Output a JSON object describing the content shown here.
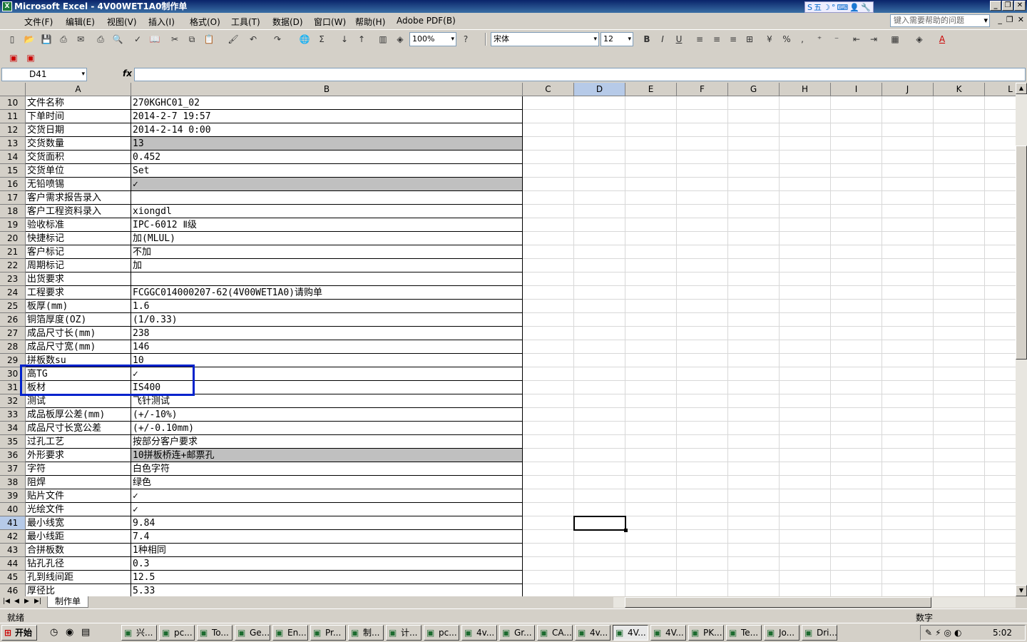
{
  "window": {
    "title": "Microsoft Excel - 4V00WET1A0制作单",
    "minimize": "_",
    "restore": "❐",
    "close": "✕"
  },
  "ime": {
    "items": [
      "S",
      "五",
      "☽",
      "°",
      "⌨",
      "👤",
      "🔧"
    ]
  },
  "menu": {
    "items": [
      "文件(F)",
      "编辑(E)",
      "视图(V)",
      "插入(I)",
      "格式(O)",
      "工具(T)",
      "数据(D)",
      "窗口(W)",
      "帮助(H)",
      "Adobe PDF(B)"
    ],
    "help_placeholder": "键入需要帮助的问题"
  },
  "toolbar": {
    "zoom": "100%",
    "font": "宋体",
    "size": "12",
    "bold": "B",
    "italic": "I",
    "underline": "U",
    "percent": "%",
    "comma": ","
  },
  "formula": {
    "name_box": "D41",
    "fx": "fx",
    "content": ""
  },
  "columns": [
    {
      "label": "A"
    },
    {
      "label": "B"
    },
    {
      "label": "C"
    },
    {
      "label": "D"
    },
    {
      "label": "E"
    },
    {
      "label": "F"
    },
    {
      "label": "G"
    },
    {
      "label": "H"
    },
    {
      "label": "I"
    },
    {
      "label": "J"
    },
    {
      "label": "K"
    },
    {
      "label": "L"
    }
  ],
  "rows": [
    {
      "n": "10",
      "a": "文件名称",
      "b": "270KGHC01_02",
      "shade": false
    },
    {
      "n": "11",
      "a": "下单时间",
      "b": "2014-2-7 19:57",
      "shade": false
    },
    {
      "n": "12",
      "a": "交货日期",
      "b": "2014-2-14 0:00",
      "shade": false
    },
    {
      "n": "13",
      "a": "交货数量",
      "b": "13",
      "shade": true
    },
    {
      "n": "14",
      "a": "交货面积",
      "b": "0.452",
      "shade": false
    },
    {
      "n": "15",
      "a": "交货单位",
      "b": "Set",
      "shade": false
    },
    {
      "n": "16",
      "a": "无铅喷锡",
      "b": "✓",
      "shade": true
    },
    {
      "n": "17",
      "a": "客户需求报告录入",
      "b": "",
      "shade": false
    },
    {
      "n": "18",
      "a": "客户工程资料录入",
      "b": "xiongdl",
      "shade": false
    },
    {
      "n": "19",
      "a": "验收标准",
      "b": "IPC-6012 Ⅱ级",
      "shade": false
    },
    {
      "n": "20",
      "a": "快捷标记",
      "b": "加(MLUL)",
      "shade": false
    },
    {
      "n": "21",
      "a": "客户标记",
      "b": "不加",
      "shade": false
    },
    {
      "n": "22",
      "a": "周期标记",
      "b": "加",
      "shade": false
    },
    {
      "n": "23",
      "a": "出货要求",
      "b": "",
      "shade": false
    },
    {
      "n": "24",
      "a": "工程要求",
      "b": "FCGGC014000207-62(4V00WET1A0)请购单",
      "shade": false
    },
    {
      "n": "25",
      "a": "板厚(mm)",
      "b": "1.6",
      "shade": false
    },
    {
      "n": "26",
      "a": "铜箔厚度(OZ)",
      "b": "(1/0.33)",
      "shade": false
    },
    {
      "n": "27",
      "a": "成品尺寸长(mm)",
      "b": "238",
      "shade": false
    },
    {
      "n": "28",
      "a": "成品尺寸宽(mm)",
      "b": "146",
      "shade": false
    },
    {
      "n": "29",
      "a": "拼板数su",
      "b": "10",
      "shade": false
    },
    {
      "n": "30",
      "a": "高TG",
      "b": "✓",
      "shade": false
    },
    {
      "n": "31",
      "a": "板材",
      "b": "IS400",
      "shade": false
    },
    {
      "n": "32",
      "a": "测试",
      "b": "飞针测试",
      "shade": false
    },
    {
      "n": "33",
      "a": "成品板厚公差(mm)",
      "b": "(+/-10%)",
      "shade": false
    },
    {
      "n": "34",
      "a": "成品尺寸长宽公差",
      "b": "(+/-0.10mm)",
      "shade": false
    },
    {
      "n": "35",
      "a": "过孔工艺",
      "b": "按部分客户要求",
      "shade": false
    },
    {
      "n": "36",
      "a": "外形要求",
      "b": "10拼板桥连+邮票孔",
      "shade": true
    },
    {
      "n": "37",
      "a": "字符",
      "b": "白色字符",
      "shade": false
    },
    {
      "n": "38",
      "a": "阻焊",
      "b": "绿色",
      "shade": false
    },
    {
      "n": "39",
      "a": "贴片文件",
      "b": "✓",
      "shade": false
    },
    {
      "n": "40",
      "a": "光绘文件",
      "b": "✓",
      "shade": false
    },
    {
      "n": "41",
      "a": "最小线宽",
      "b": "9.84",
      "shade": false
    },
    {
      "n": "42",
      "a": "最小线距",
      "b": "7.4",
      "shade": false
    },
    {
      "n": "43",
      "a": "合拼板数",
      "b": "1种相同",
      "shade": false
    },
    {
      "n": "44",
      "a": "钻孔孔径",
      "b": "0.3",
      "shade": false
    },
    {
      "n": "45",
      "a": "孔到线间距",
      "b": "12.5",
      "shade": false
    },
    {
      "n": "46",
      "a": "厚径比",
      "b": "5.33",
      "shade": false
    }
  ],
  "sheet": {
    "tab": "制作单"
  },
  "status": {
    "left": "就绪",
    "right": "数字"
  },
  "taskbar": {
    "start": "开始",
    "tasks": [
      "兴...",
      "pc...",
      "To...",
      "Ge...",
      "En...",
      "Pr...",
      "制...",
      "计...",
      "pc...",
      "4v...",
      "Gr...",
      "CA...",
      "4v...",
      "4V...",
      "4V...",
      "PK...",
      "Te...",
      "Jo...",
      "Dri..."
    ],
    "active_index": 13,
    "clock": "5:02"
  },
  "colors": {
    "highlight_border": "#0022cc",
    "shade": "#c0c0c0",
    "title_bar": "#0a246a"
  }
}
